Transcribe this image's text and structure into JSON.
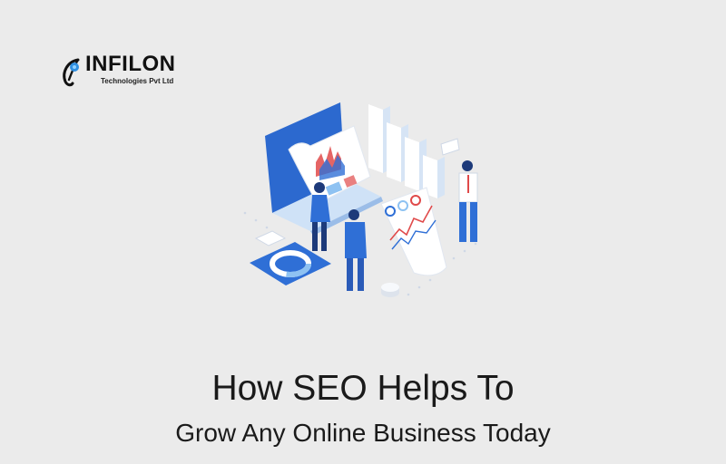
{
  "brand": {
    "name": "INFILON",
    "tagline": "Technologies Pvt Ltd",
    "colors": {
      "accent": "#2f8fe0",
      "dark": "#111111"
    }
  },
  "hero": {
    "illustration": "seo-analytics-illustration",
    "title": "How SEO Helps To",
    "subtitle": "Grow Any Online Business Today"
  },
  "colors": {
    "background": "#ebebeb",
    "primary_blue": "#2f6fd6",
    "light_blue": "#8ec2f2",
    "red": "#e04a4a",
    "text": "#1a1a1a"
  }
}
